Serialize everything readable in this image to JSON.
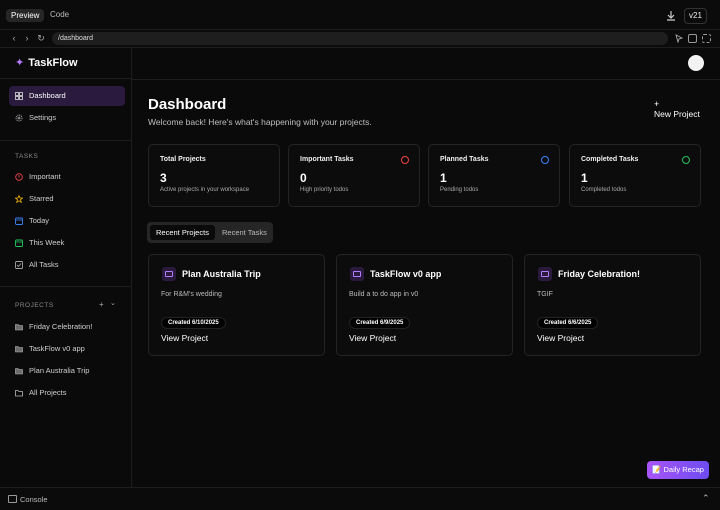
{
  "topbar": {
    "tabs": [
      {
        "label": "Preview"
      },
      {
        "label": "Code"
      }
    ],
    "version": "v21"
  },
  "urlbar": {
    "url": "/dashboard"
  },
  "sidebar": {
    "app_name": "TaskFlow",
    "nav": [
      {
        "label": "Dashboard",
        "icon": "grid-icon",
        "active": true
      },
      {
        "label": "Settings",
        "icon": "gear-icon"
      }
    ],
    "tasks_heading": "TASKS",
    "tasks": [
      {
        "label": "Important",
        "icon": "alert-circle-icon",
        "color": "#ef4444"
      },
      {
        "label": "Starred",
        "icon": "star-icon",
        "color": "#eab308"
      },
      {
        "label": "Today",
        "icon": "calendar-icon",
        "color": "#3b82f6"
      },
      {
        "label": "This Week",
        "icon": "calendar-week-icon",
        "color": "#22c55e"
      },
      {
        "label": "All Tasks",
        "icon": "checkbox-icon",
        "color": "#a3a3a3"
      }
    ],
    "projects_heading": "PROJECTS",
    "add_symbol": "+",
    "chevron_symbol": "⌄",
    "projects": [
      {
        "label": "Friday Celebration!",
        "icon": "folder-icon"
      },
      {
        "label": "TaskFlow v0 app",
        "icon": "folder-icon"
      },
      {
        "label": "Plan Australia Trip",
        "icon": "folder-icon"
      },
      {
        "label": "All Projects",
        "icon": "folder-open-icon"
      }
    ]
  },
  "main": {
    "title": "Dashboard",
    "subtitle": "Welcome back! Here's what's happening with your projects.",
    "new_project_plus": "+",
    "new_project_label": "New Project",
    "stats": [
      {
        "label": "Total Projects",
        "value": "3",
        "desc": "Active projects in your workspace"
      },
      {
        "label": "Important Tasks",
        "value": "0",
        "desc": "High priority todos",
        "icon": "alert-circle-icon",
        "color": "#ef4444"
      },
      {
        "label": "Planned Tasks",
        "value": "1",
        "desc": "Pending todos",
        "icon": "clock-icon",
        "color": "#3b82f6"
      },
      {
        "label": "Completed Tasks",
        "value": "1",
        "desc": "Completed todos",
        "icon": "check-circle-icon",
        "color": "#22c55e"
      }
    ],
    "tabs": [
      {
        "label": "Recent Projects",
        "active": true
      },
      {
        "label": "Recent Tasks"
      }
    ],
    "projects": [
      {
        "name": "Plan Australia Trip",
        "desc": "For R&M's wedding",
        "created": "Created 6/10/2025",
        "link": "View Project"
      },
      {
        "name": "TaskFlow v0 app",
        "desc": "Build a to do app in v0",
        "created": "Created 6/9/2025",
        "link": "View Project"
      },
      {
        "name": "Friday Celebration!",
        "desc": "TGIF",
        "created": "Created 6/6/2025",
        "link": "View Project"
      }
    ],
    "recap_label": "📝 Daily Recap"
  },
  "console": {
    "label": "Console",
    "collapse_symbol": "⌃"
  },
  "colors": {
    "accent": "#b47cff",
    "active_bg": "#2a1a3d"
  }
}
